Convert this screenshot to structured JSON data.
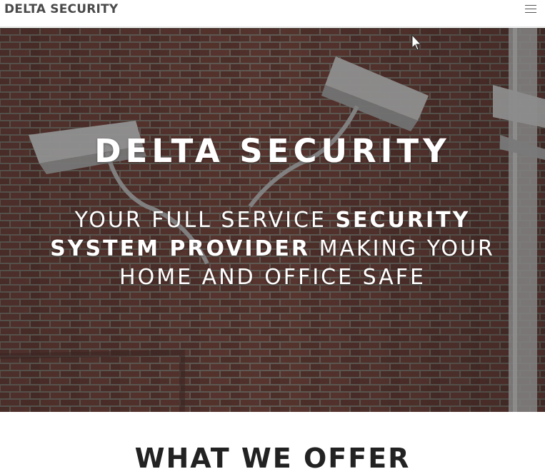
{
  "navbar": {
    "brand": "DELTA SECURITY",
    "menu_icon": "hamburger-menu-icon"
  },
  "hero": {
    "title": "DELTA SECURITY",
    "subtitle_part1": "YOUR FULL SERVICE ",
    "subtitle_bold": "SECURITY SYSTEM PROVIDER",
    "subtitle_part2": " MAKING YOUR HOME AND OFFICE SAFE",
    "background": "brick-wall-security-cameras-image"
  },
  "section": {
    "heading": "WHAT WE OFFER"
  },
  "colors": {
    "brand_text": "#4a4a4a",
    "hero_text": "#ffffff",
    "brick": "#7a3e33",
    "overlay": "#282828"
  }
}
